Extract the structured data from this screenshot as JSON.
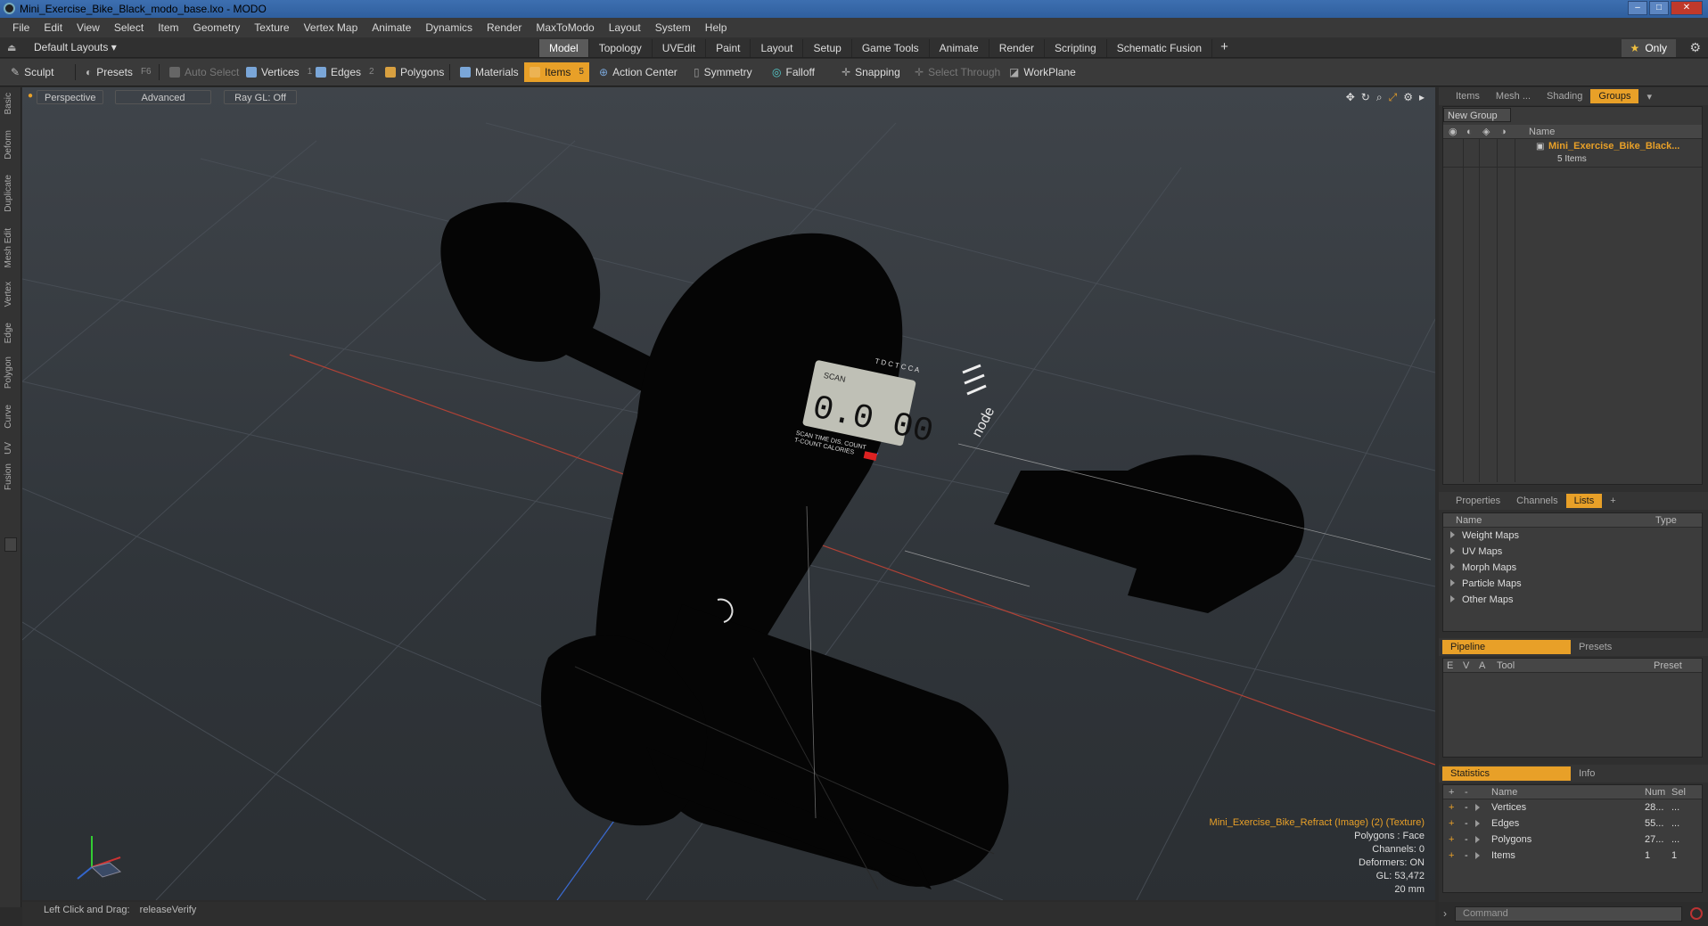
{
  "window": {
    "title": "Mini_Exercise_Bike_Black_modo_base.lxo - MODO"
  },
  "menu": [
    "File",
    "Edit",
    "View",
    "Select",
    "Item",
    "Geometry",
    "Texture",
    "Vertex Map",
    "Animate",
    "Dynamics",
    "Render",
    "MaxToModo",
    "Layout",
    "System",
    "Help"
  ],
  "layouts": {
    "selector": "Default Layouts ▾",
    "tabs": [
      "Model",
      "Topology",
      "UVEdit",
      "Paint",
      "Layout",
      "Setup",
      "Game Tools",
      "Animate",
      "Render",
      "Scripting",
      "Schematic Fusion"
    ],
    "active": "Model",
    "only_label": "Only"
  },
  "toolbar": {
    "sculpt": "Sculpt",
    "presets": "Presets",
    "presets_key": "F6",
    "auto_select": "Auto Select",
    "vertices": "Vertices",
    "vertices_num": "1",
    "edges": "Edges",
    "edges_num": "2",
    "polygons": "Polygons",
    "materials": "Materials",
    "items": "Items",
    "items_num": "5",
    "action_center": "Action Center",
    "symmetry": "Symmetry",
    "falloff": "Falloff",
    "snapping": "Snapping",
    "select_through": "Select Through",
    "workplane": "WorkPlane"
  },
  "left_tabs": [
    "Basic",
    "Deform",
    "Duplicate",
    "Mesh Edit",
    "Vertex",
    "Edge",
    "Polygon",
    "Curve",
    "UV",
    "Fusion"
  ],
  "viewport": {
    "view": "Perspective",
    "shading": "Advanced",
    "raygl": "Ray GL: Off",
    "display_text": {
      "brand": "T D C T C C A",
      "lcd_mode": "SCAN",
      "lcd_digits": "0.0 00",
      "lcd_labels": "SCAN TIME DIS. COUNT",
      "lcd_labels2": "T-COUNT CALORIES",
      "logo": "node"
    },
    "info": {
      "texture": "Mini_Exercise_Bike_Refract (Image) (2) (Texture)",
      "polygons": "Polygons : Face",
      "channels": "Channels: 0",
      "deformers": "Deformers: ON",
      "gl": "GL: 53,472",
      "scale": "20 mm"
    }
  },
  "status": {
    "hint": "Left Click and Drag:",
    "action": "releaseVerify"
  },
  "groups_panel": {
    "tabs": [
      "Items",
      "Mesh ...",
      "Shading",
      "Groups"
    ],
    "active": "Groups",
    "new_group": "New Group",
    "col_name": "Name",
    "group_name": "Mini_Exercise_Bike_Black...",
    "group_count": "5 Items"
  },
  "lists_panel": {
    "tabs": [
      "Properties",
      "Channels",
      "Lists"
    ],
    "active": "Lists",
    "col_name": "Name",
    "col_type": "Type",
    "items": [
      "Weight Maps",
      "UV Maps",
      "Morph Maps",
      "Particle Maps",
      "Other Maps"
    ]
  },
  "pipeline_panel": {
    "tabs": [
      "Pipeline",
      "Presets"
    ],
    "active": "Pipeline",
    "cols": [
      "E",
      "V",
      "A",
      "Tool",
      "Preset"
    ]
  },
  "stats_panel": {
    "tabs": [
      "Statistics",
      "Info"
    ],
    "active": "Statistics",
    "cols": {
      "name": "Name",
      "num": "Num",
      "sel": "Sel"
    },
    "rows": [
      {
        "name": "Vertices",
        "num": "28...",
        "sel": "..."
      },
      {
        "name": "Edges",
        "num": "55...",
        "sel": "..."
      },
      {
        "name": "Polygons",
        "num": "27...",
        "sel": "..."
      },
      {
        "name": "Items",
        "num": "1",
        "sel": "1"
      }
    ]
  },
  "command": {
    "placeholder": "Command"
  },
  "colors": {
    "accent": "#e8a028",
    "red_axis": "#c0392b",
    "blue_axis": "#3a6ad0"
  }
}
